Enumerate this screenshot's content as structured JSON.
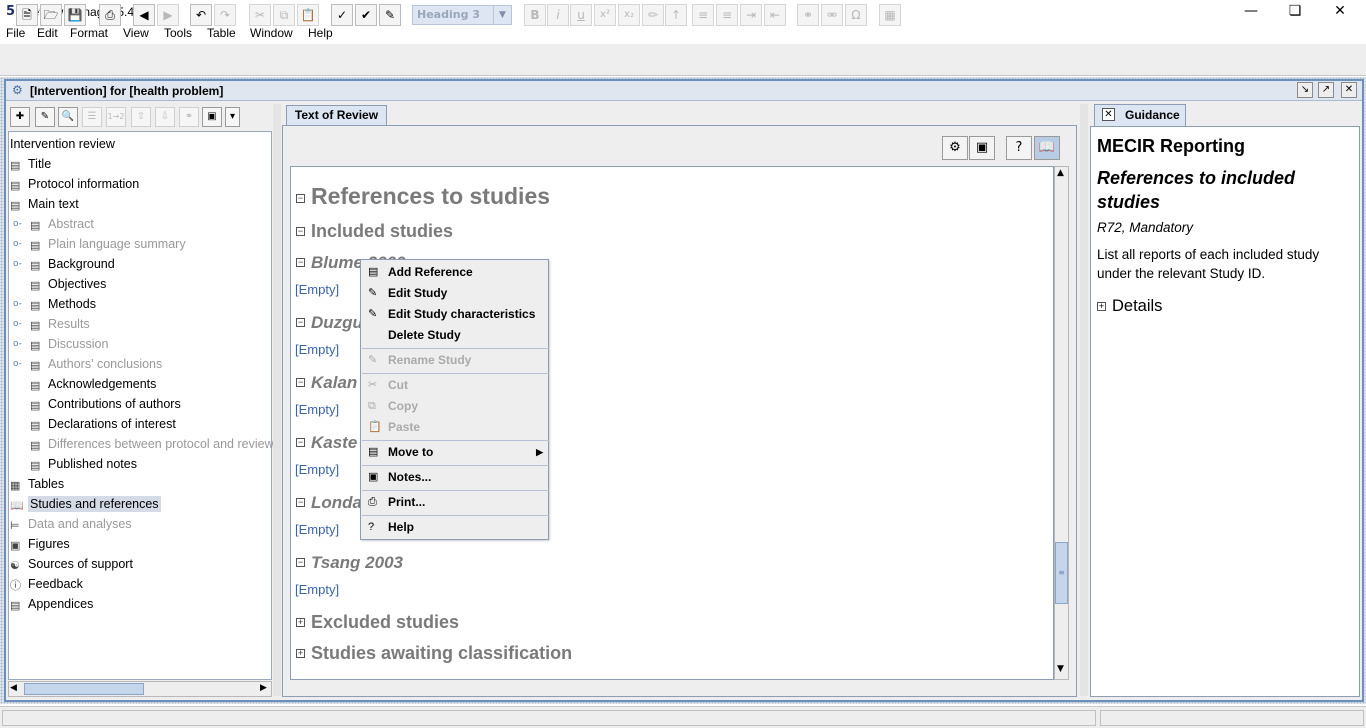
{
  "window": {
    "title": "Review Manager 5.4.1",
    "app_icon": "5"
  },
  "menubar": {
    "items": [
      "File",
      "Edit",
      "Format",
      "View",
      "Tools",
      "Table",
      "Window",
      "Help"
    ]
  },
  "toolbar": {
    "style_combo_value": "Heading 3"
  },
  "frame": {
    "title": "[Intervention] for [health problem]"
  },
  "tree": {
    "root": "Intervention review",
    "items": [
      {
        "label": "Title",
        "level": 1,
        "gray": false
      },
      {
        "label": "Protocol information",
        "level": 1,
        "gray": false
      },
      {
        "label": "Main text",
        "level": 1,
        "gray": false
      },
      {
        "label": "Abstract",
        "level": 2,
        "gray": true
      },
      {
        "label": "Plain language summary",
        "level": 2,
        "gray": true
      },
      {
        "label": "Background",
        "level": 2,
        "gray": false
      },
      {
        "label": "Objectives",
        "level": 2,
        "gray": false
      },
      {
        "label": "Methods",
        "level": 2,
        "gray": false
      },
      {
        "label": "Results",
        "level": 2,
        "gray": true
      },
      {
        "label": "Discussion",
        "level": 2,
        "gray": true
      },
      {
        "label": "Authors' conclusions",
        "level": 2,
        "gray": true
      },
      {
        "label": "Acknowledgements",
        "level": 2,
        "gray": false
      },
      {
        "label": "Contributions of authors",
        "level": 2,
        "gray": false
      },
      {
        "label": "Declarations of interest",
        "level": 2,
        "gray": false
      },
      {
        "label": "Differences between protocol and review",
        "level": 2,
        "gray": true
      },
      {
        "label": "Published notes",
        "level": 2,
        "gray": false
      },
      {
        "label": "Tables",
        "level": 1,
        "gray": false
      },
      {
        "label": "Studies and references",
        "level": 1,
        "gray": false,
        "selected": true
      },
      {
        "label": "Data and analyses",
        "level": 1,
        "gray": true
      },
      {
        "label": "Figures",
        "level": 1,
        "gray": false
      },
      {
        "label": "Sources of support",
        "level": 1,
        "gray": false
      },
      {
        "label": "Feedback",
        "level": 1,
        "gray": false
      },
      {
        "label": "Appendices",
        "level": 1,
        "gray": false
      }
    ]
  },
  "center": {
    "tab_label": "Text of Review",
    "heading_main": "References to studies",
    "heading_included": "Included studies",
    "studies": [
      "Blume 2000",
      "Duzgun",
      "Kalan",
      "Kaste",
      "Londa",
      "Tsang 2003"
    ],
    "empty_label": "[Empty]",
    "heading_excluded": "Excluded studies",
    "heading_awaiting": "Studies awaiting classification"
  },
  "context_menu": {
    "add_reference": "Add Reference",
    "edit_study": "Edit Study",
    "edit_study_characteristics": "Edit Study characteristics",
    "delete_study": "Delete Study",
    "rename_study": "Rename Study",
    "cut": "Cut",
    "copy": "Copy",
    "paste": "Paste",
    "move_to": "Move to",
    "notes": "Notes...",
    "print": "Print...",
    "help": "Help"
  },
  "guidance": {
    "tab_label": "Guidance",
    "title": "MECIR Reporting",
    "subtitle": "References to included studies",
    "code": "R72, Mandatory",
    "body": "List all reports of each included study under the relevant Study ID.",
    "details": "Details"
  }
}
